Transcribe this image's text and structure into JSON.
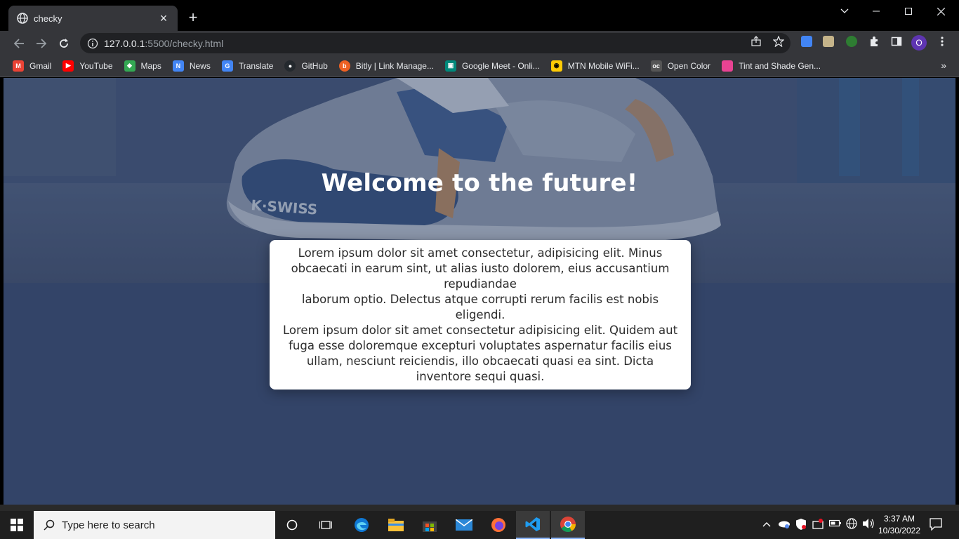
{
  "browser": {
    "tab_title": "checky",
    "url_host": "127.0.0.1",
    "url_path": ":5500/checky.html",
    "profile_initial": "O"
  },
  "bookmarks": [
    {
      "label": "Gmail",
      "icon": "gmail-icon",
      "color": "#ea4335"
    },
    {
      "label": "YouTube",
      "icon": "youtube-icon",
      "color": "#ff0000"
    },
    {
      "label": "Maps",
      "icon": "maps-icon",
      "color": "#34a853"
    },
    {
      "label": "News",
      "icon": "news-icon",
      "color": "#4285f4"
    },
    {
      "label": "Translate",
      "icon": "translate-icon",
      "color": "#4285f4"
    },
    {
      "label": "GitHub",
      "icon": "github-icon",
      "color": "#24292e"
    },
    {
      "label": "Bitly | Link Manage...",
      "icon": "bitly-icon",
      "color": "#ee6123"
    },
    {
      "label": "Google Meet - Onli...",
      "icon": "meet-icon",
      "color": "#00897b"
    },
    {
      "label": "MTN Mobile WiFi...",
      "icon": "mtn-icon",
      "color": "#ffcb05"
    },
    {
      "label": "Open Color",
      "icon": "opencolor-icon",
      "color": "#555555"
    },
    {
      "label": "Tint and Shade Gen...",
      "icon": "tint-icon",
      "color": "#e84393"
    }
  ],
  "page": {
    "title": "Welcome to the future!",
    "paragraph_1": "Lorem ipsum dolor sit amet consectetur, adipisicing elit. Minus obcaecati in earum sint, ut alias iusto dolorem, eius accusantium repudiandae",
    "paragraph_2": "laborum optio. Delectus atque corrupti rerum facilis est nobis eligendi.",
    "paragraph_3": "Lorem ipsum dolor sit amet consectetur adipisicing elit. Quidem aut fuga esse doloremque excepturi voluptates aspernatur facilis eius ullam, nesciunt reiciendis, illo obcaecati quasi ea sint. Dicta inventore sequi quasi.",
    "shoe_brand": "K·SWISS",
    "background_color": "#334468"
  },
  "taskbar": {
    "search_placeholder": "Type here to search",
    "time": "3:37 AM",
    "date": "10/30/2022"
  }
}
